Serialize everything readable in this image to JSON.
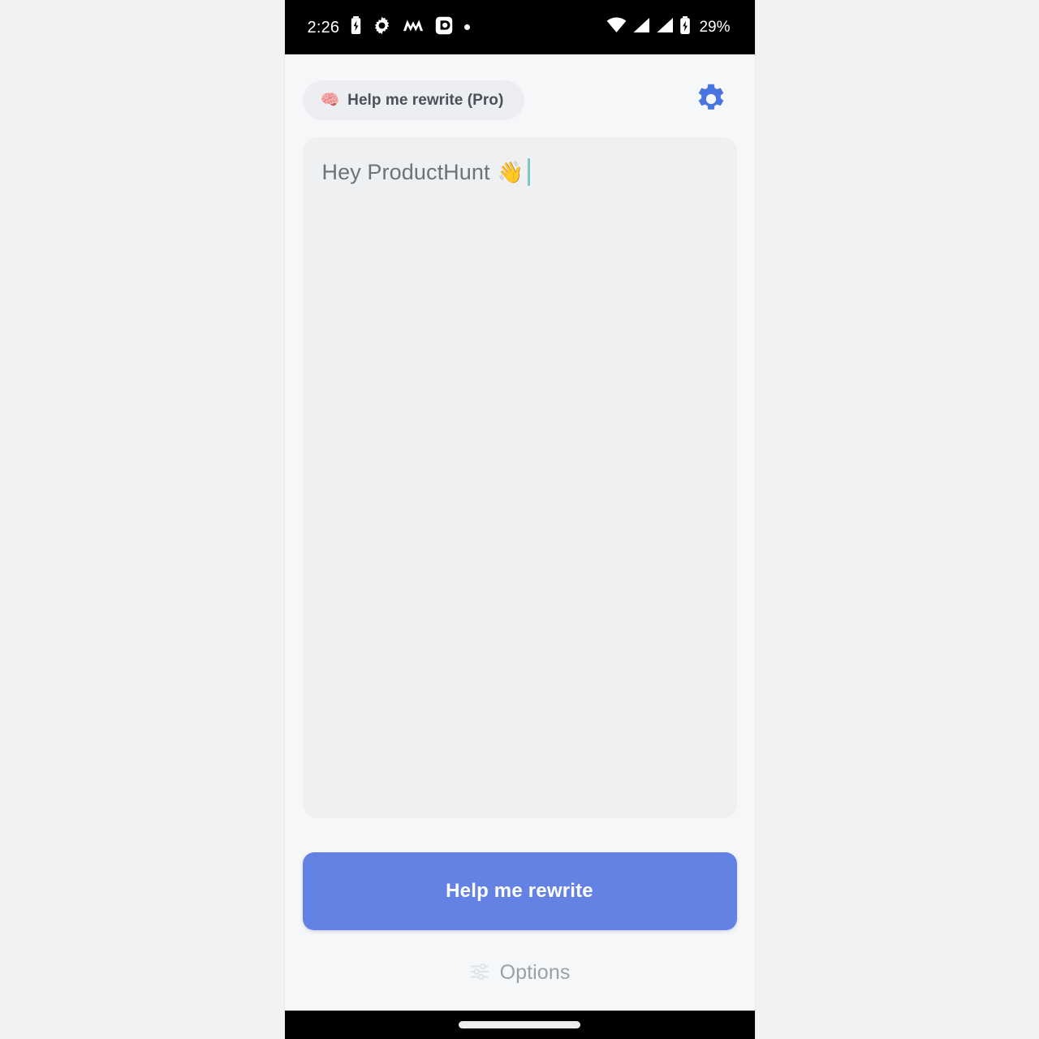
{
  "status_bar": {
    "time": "2:26",
    "battery_percent": "29%",
    "left_icons": [
      "battery-charging-icon",
      "gear-notification-icon",
      "m-app-notification-icon",
      "rounded-square-app-notification-icon",
      "more-notifications-dot"
    ],
    "right_icons": [
      "wifi-icon",
      "cellular-signal-1-icon",
      "cellular-signal-2-icon",
      "battery-charging-icon"
    ]
  },
  "top_bar": {
    "mode_chip": {
      "emoji": "🧠",
      "label": "Help me rewrite (Pro)"
    },
    "settings_icon": "gear-icon",
    "settings_color": "#4a74e0"
  },
  "editor": {
    "text": "Hey ProductHunt",
    "emoji": "👋",
    "caret_color": "#7fc6c8",
    "background": "#eff0f2"
  },
  "footer": {
    "primary_button": {
      "label": "Help me rewrite",
      "color": "#6482e4",
      "text_color": "#ffffff"
    },
    "options": {
      "icon": "sliders-tune-icon",
      "label": "Options"
    }
  },
  "nav_bar": {
    "gesture_pill": "home-gesture-pill"
  }
}
